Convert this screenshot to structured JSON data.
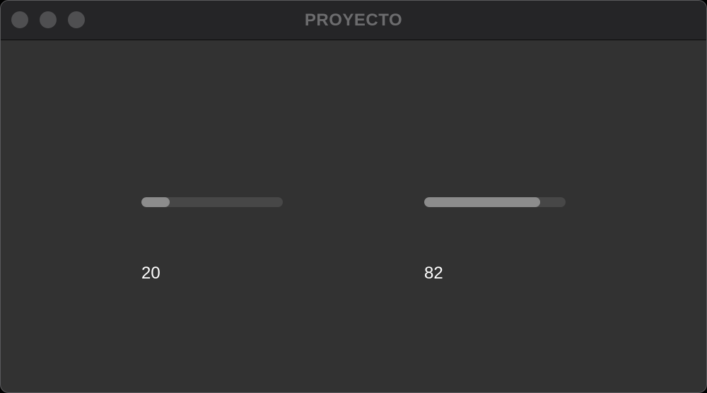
{
  "window": {
    "title": "PROYECTO"
  },
  "sliders": [
    {
      "value_label": "20",
      "fill_fraction": 0.2
    },
    {
      "value_label": "82",
      "fill_fraction": 0.82
    }
  ],
  "colors": {
    "window_bg": "#323232",
    "titlebar_bg": "#252527",
    "track": "#474747",
    "fill": "#8c8c8c",
    "value_text": "#ffffff",
    "title_text": "#6c6c6e"
  }
}
